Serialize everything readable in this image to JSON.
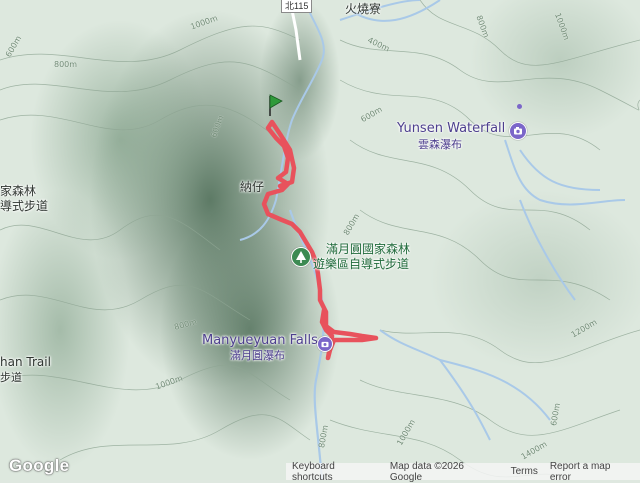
{
  "colors": {
    "route": "#e8525c",
    "poi": "#7b66c9",
    "park_icon": "#3c8a52",
    "river": "#a9c9e8",
    "terrain_light": "#e3ece4",
    "terrain_dark": "#6f8f78"
  },
  "icons": {
    "start_marker": "green-flag-pin-icon",
    "camera_poi": "camera-icon",
    "park": "tree-icon"
  },
  "road": {
    "shield": "北115"
  },
  "places": {
    "huoshaoliao": "火燒寮",
    "nazai": "納仔",
    "left_top": "家森林",
    "left_bottom": "導式步道",
    "trail_left": "han Trail",
    "trail_left_zh": "步道"
  },
  "pois": {
    "yunsen_en": "Yunsen Waterfall",
    "yunsen_zh": "雲森瀑布",
    "manyueyuan_en": "Manyueyuan Falls",
    "manyueyuan_zh": "滿月圓瀑布"
  },
  "park": {
    "line1": "滿月圓國家森林",
    "line2": "遊樂區自導式步道"
  },
  "contours": [
    "600m",
    "800m",
    "1000m",
    "600m",
    "400m",
    "600m",
    "800m",
    "1000m",
    "800m",
    "1000m",
    "800m",
    "1200m",
    "1400m",
    "1000m",
    "800m",
    "600m"
  ],
  "footer": {
    "logo": "Google",
    "keyboard": "Keyboard shortcuts",
    "mapdata": "Map data ©2026 Google",
    "terms": "Terms",
    "report": "Report a map error"
  }
}
